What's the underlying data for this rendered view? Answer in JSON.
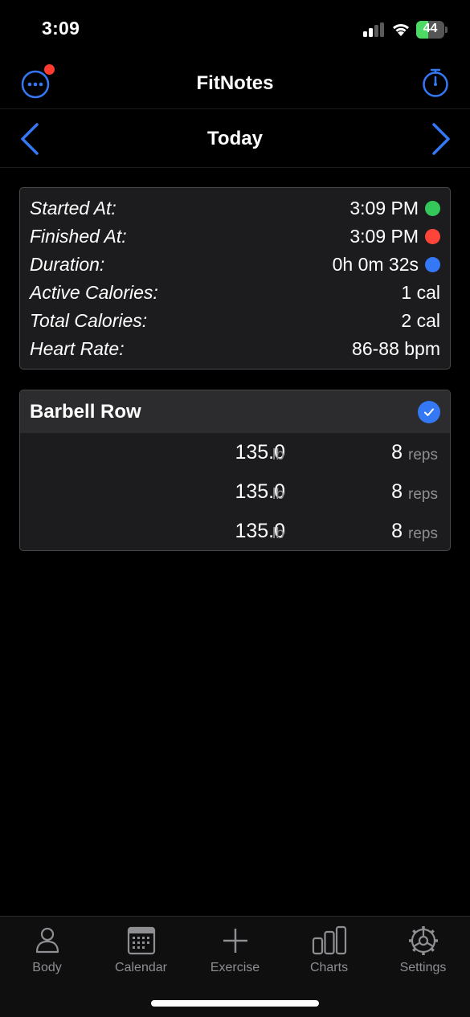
{
  "status_bar": {
    "time": "3:09",
    "battery_level": "44",
    "battery_fill_percent": 44
  },
  "nav": {
    "title": "FitNotes",
    "menu_icon": "ellipsis-circle-icon",
    "stopwatch_icon": "stopwatch-icon",
    "notification_color": "#ff3b30"
  },
  "date_bar": {
    "title": "Today",
    "prev_icon": "chevron-left-icon",
    "next_icon": "chevron-right-icon"
  },
  "stats": [
    {
      "label": "Started At:",
      "value": "3:09 PM",
      "dot_color": "#34c759"
    },
    {
      "label": "Finished At:",
      "value": "3:09 PM",
      "dot_color": "#ff453a"
    },
    {
      "label": "Duration:",
      "value": "0h 0m 32s",
      "dot_color": "#3478f6"
    },
    {
      "label": "Active Calories:",
      "value": "1 cal",
      "dot_color": null
    },
    {
      "label": "Total Calories:",
      "value": "2 cal",
      "dot_color": null
    },
    {
      "label": "Heart Rate:",
      "value": "86-88 bpm",
      "dot_color": null
    }
  ],
  "exercise": {
    "name": "Barbell Row",
    "completed_icon": "checkmark-circle-icon",
    "sets": [
      {
        "weight": "135.0",
        "weight_unit": "lb",
        "reps": "8",
        "reps_unit": "reps"
      },
      {
        "weight": "135.0",
        "weight_unit": "lb",
        "reps": "8",
        "reps_unit": "reps"
      },
      {
        "weight": "135.0",
        "weight_unit": "lb",
        "reps": "8",
        "reps_unit": "reps"
      }
    ]
  },
  "tabs": [
    {
      "label": "Body",
      "icon": "person-icon"
    },
    {
      "label": "Calendar",
      "icon": "calendar-icon"
    },
    {
      "label": "Exercise",
      "icon": "plus-icon"
    },
    {
      "label": "Charts",
      "icon": "bar-chart-icon"
    },
    {
      "label": "Settings",
      "icon": "gear-icon"
    }
  ],
  "colors": {
    "accent": "#3478f6",
    "background": "#000000",
    "card": "#1c1c1e",
    "secondary_text": "#8e8e93"
  }
}
